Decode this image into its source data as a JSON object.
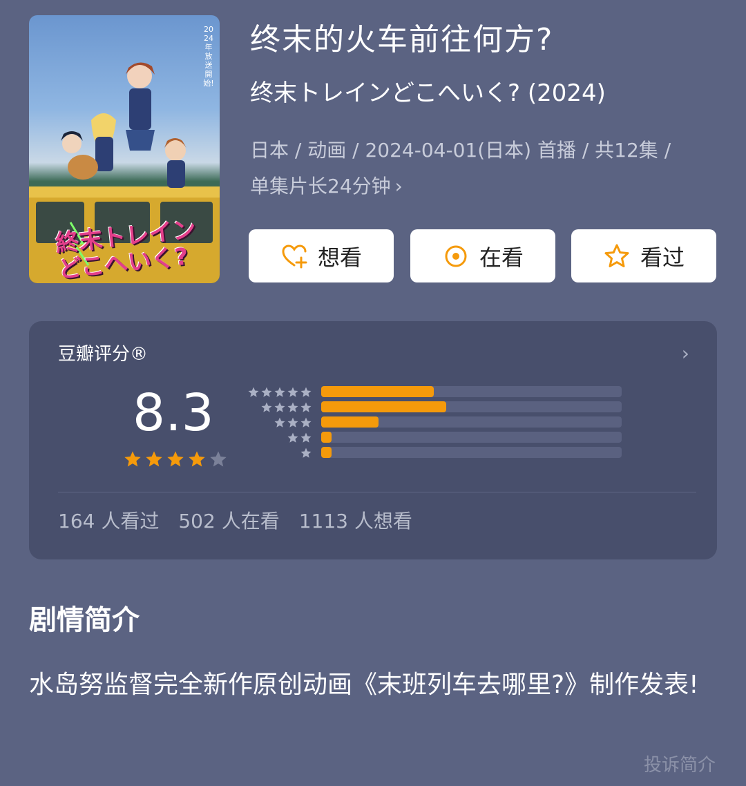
{
  "poster": {
    "image": "anime-poster",
    "logo_text": "終末トレインどこへいく?",
    "vertical_text": "2024年 放送開始!"
  },
  "movie": {
    "title": "终末的火车前往何方?",
    "subtitle": "终末トレインどこへいく? (2024)",
    "meta_line1": "日本 / 动画 / 2024-04-01(日本) 首播 / 共12集 /",
    "meta_line2": "单集片长24分钟",
    "meta_chevron": "›"
  },
  "actions": [
    {
      "label": "想看",
      "icon": "heart-plus-icon"
    },
    {
      "label": "在看",
      "icon": "target-icon"
    },
    {
      "label": "看过",
      "icon": "star-outline-icon"
    }
  ],
  "rating": {
    "label": "豆瓣评分®",
    "chevron": "›",
    "score": "8.3",
    "stars_filled": 4,
    "stars_total": 5,
    "distribution": [
      {
        "stars": 5,
        "fraction": 0.375
      },
      {
        "stars": 4,
        "fraction": 0.415
      },
      {
        "stars": 3,
        "fraction": 0.19
      },
      {
        "stars": 2,
        "fraction": 0.035
      },
      {
        "stars": 1,
        "fraction": 0.035
      }
    ],
    "counts": {
      "watched": "164 人看过",
      "watching": "502 人在看",
      "want": "1113 人想看"
    }
  },
  "synopsis": {
    "heading": "剧情简介",
    "text": "水岛努监督完全新作原创动画《末班列车去哪里?》制作发表!",
    "report_label": "投诉简介"
  },
  "colors": {
    "background": "#5b6382",
    "card": "#484f6c",
    "accent": "#f59a0b"
  }
}
